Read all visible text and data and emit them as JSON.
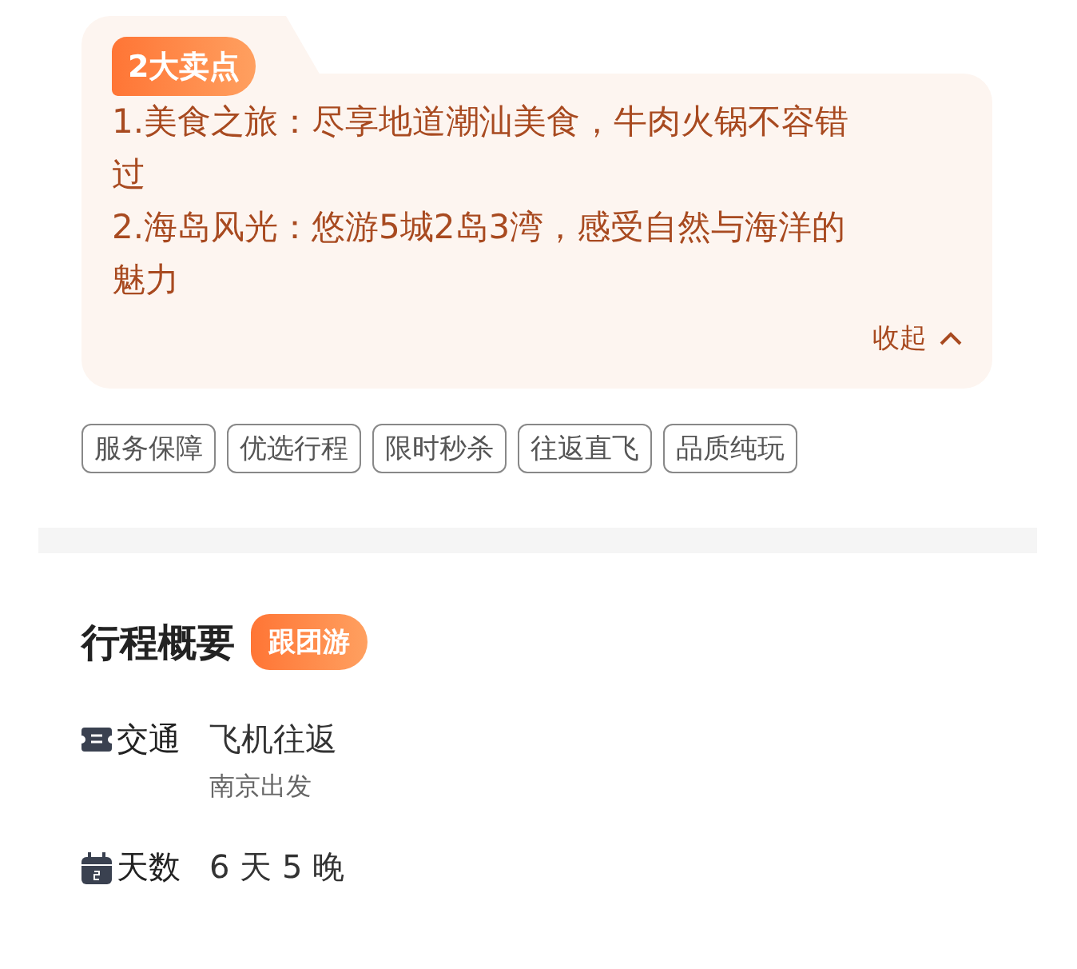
{
  "highlights": {
    "badge": "2大卖点",
    "points": [
      "1.美食之旅：尽享地道潮汕美食，牛肉火锅不容错过",
      "2.海岛风光：悠游5城2岛3湾，感受自然与海洋的魅力"
    ],
    "collapse": "收起",
    "expanded": true
  },
  "tags": [
    "服务保障",
    "优选行程",
    "限时秒杀",
    "往返直飞",
    "品质纯玩"
  ],
  "overview": {
    "title": "行程概要",
    "badge": "跟团游",
    "rows": [
      {
        "kind": "transport",
        "label": "交通",
        "value": "飞机往返",
        "note": "南京出发"
      },
      {
        "kind": "duration",
        "label": "天数",
        "value": "6 天 5 晚"
      }
    ]
  }
}
